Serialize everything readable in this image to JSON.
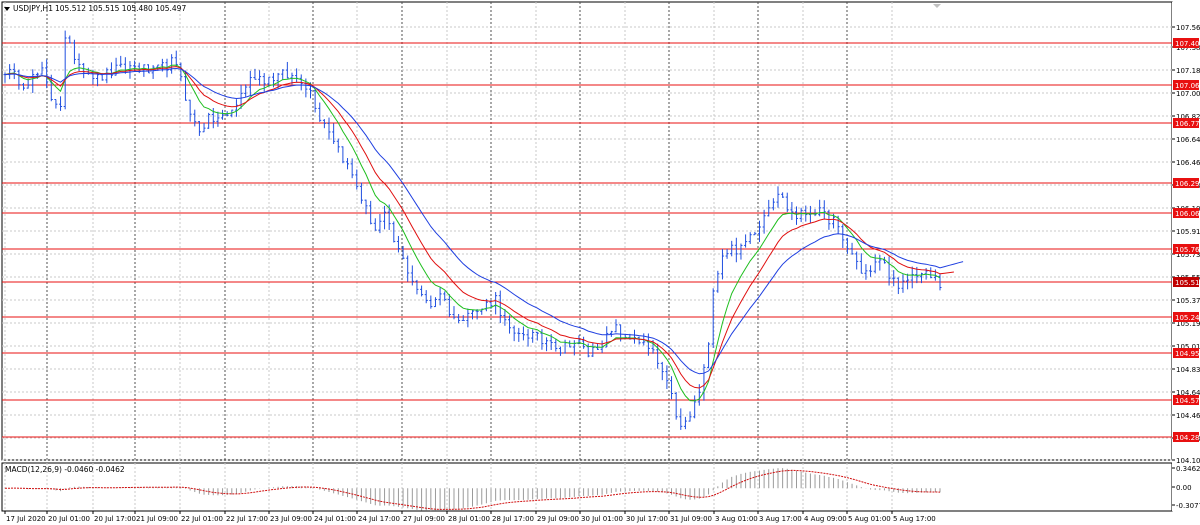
{
  "header": {
    "symbol_label": "USDJPY,H1",
    "ohlc_text": "105.512 105.515 105.480 105.497"
  },
  "macd_label": "MACD(12,26,9) -0.0460 -0.0462",
  "colors": {
    "candle": "#1f4fe0",
    "ma_fast": "#1fbf1f",
    "ma_mid": "#e01010",
    "ma_slow": "#1f3fe0",
    "level_line": "#e81010",
    "level_badge": "#e81010",
    "macd_signal": "#d01010",
    "macd_hist": "#9a9a9a",
    "grid": "#c8c8c8"
  },
  "chart_data": [
    {
      "type": "candlestick",
      "title": "USDJPY,H1",
      "ylim": [
        104.105,
        107.62
      ],
      "price_ticks": [
        "107.565",
        "107.385",
        "107.185",
        "107.005",
        "106.825",
        "106.640",
        "106.460",
        "106.280",
        "106.100",
        "105.915",
        "105.735",
        "105.555",
        "105.370",
        "105.190",
        "105.010",
        "104.830",
        "104.645",
        "104.465",
        "104.285",
        "104.105"
      ],
      "x_ticks": [
        "17 Jul 2020",
        "20 Jul 01:00",
        "20 Jul 17:00",
        "21 Jul 09:00",
        "22 Jul 01:00",
        "22 Jul 17:00",
        "23 Jul 09:00",
        "24 Jul 01:00",
        "24 Jul 17:00",
        "27 Jul 09:00",
        "28 Jul 01:00",
        "28 Jul 17:00",
        "29 Jul 09:00",
        "30 Jul 01:00",
        "30 Jul 17:00",
        "31 Jul 09:00",
        "3 Aug 01:00",
        "3 Aug 17:00",
        "4 Aug 09:00",
        "5 Aug 01:00",
        "5 Aug 17:00"
      ],
      "horizontal_levels": [
        "107.402",
        "107.062",
        "106.770",
        "106.294",
        "106.060",
        "105.761",
        "105.514",
        "105.240",
        "104.950",
        "104.575",
        "104.284"
      ],
      "current_price": "105.514",
      "price_path": [
        [
          0,
          107.22
        ],
        [
          4,
          107.12
        ],
        [
          8,
          107.2
        ],
        [
          10,
          107.0
        ],
        [
          12,
          106.95
        ],
        [
          13,
          107.45
        ],
        [
          16,
          107.28
        ],
        [
          20,
          107.15
        ],
        [
          24,
          107.22
        ],
        [
          28,
          107.25
        ],
        [
          32,
          107.2
        ],
        [
          36,
          107.28
        ],
        [
          38,
          107.18
        ],
        [
          40,
          106.85
        ],
        [
          42,
          106.75
        ],
        [
          44,
          106.82
        ],
        [
          48,
          106.85
        ],
        [
          50,
          106.95
        ],
        [
          52,
          107.1
        ],
        [
          54,
          107.18
        ],
        [
          56,
          107.15
        ],
        [
          60,
          107.18
        ],
        [
          64,
          107.15
        ],
        [
          66,
          107.05
        ],
        [
          68,
          106.85
        ],
        [
          70,
          106.75
        ],
        [
          72,
          106.6
        ],
        [
          74,
          106.45
        ],
        [
          76,
          106.3
        ],
        [
          78,
          106.1
        ],
        [
          80,
          105.95
        ],
        [
          82,
          106.05
        ],
        [
          84,
          105.85
        ],
        [
          86,
          105.7
        ],
        [
          88,
          105.55
        ],
        [
          90,
          105.4
        ],
        [
          92,
          105.35
        ],
        [
          94,
          105.45
        ],
        [
          96,
          105.3
        ],
        [
          98,
          105.2
        ],
        [
          100,
          105.32
        ],
        [
          102,
          105.28
        ],
        [
          104,
          105.35
        ],
        [
          106,
          105.4
        ],
        [
          108,
          105.2
        ],
        [
          110,
          105.08
        ],
        [
          112,
          105.12
        ],
        [
          114,
          105.1
        ],
        [
          116,
          105.05
        ],
        [
          118,
          105.08
        ],
        [
          120,
          104.98
        ],
        [
          122,
          105.05
        ],
        [
          124,
          105.03
        ],
        [
          126,
          104.95
        ],
        [
          128,
          105.02
        ],
        [
          130,
          105.08
        ],
        [
          132,
          105.15
        ],
        [
          134,
          105.05
        ],
        [
          136,
          105.1
        ],
        [
          138,
          105.02
        ],
        [
          140,
          104.95
        ],
        [
          142,
          104.8
        ],
        [
          144,
          104.6
        ],
        [
          146,
          104.35
        ],
        [
          148,
          104.45
        ],
        [
          150,
          104.65
        ],
        [
          152,
          105.0
        ],
        [
          153,
          105.5
        ],
        [
          155,
          105.75
        ],
        [
          157,
          105.8
        ],
        [
          159,
          105.78
        ],
        [
          161,
          105.9
        ],
        [
          163,
          106.0
        ],
        [
          165,
          106.15
        ],
        [
          167,
          106.25
        ],
        [
          169,
          106.12
        ],
        [
          171,
          106.05
        ],
        [
          173,
          106.08
        ],
        [
          175,
          106.1
        ],
        [
          177,
          106.05
        ],
        [
          179,
          106.02
        ],
        [
          181,
          105.85
        ],
        [
          183,
          105.75
        ],
        [
          185,
          105.62
        ],
        [
          187,
          105.6
        ],
        [
          189,
          105.72
        ],
        [
          191,
          105.6
        ],
        [
          193,
          105.45
        ],
        [
          195,
          105.55
        ],
        [
          197,
          105.6
        ],
        [
          199,
          105.58
        ],
        [
          201,
          105.55
        ],
        [
          202,
          105.5
        ]
      ]
    },
    {
      "type": "macd",
      "title": "MACD(12,26,9)",
      "ylim": [
        -0.3077,
        0.3462
      ],
      "ticks": [
        "0.3462",
        "0.00",
        "-0.3077"
      ],
      "main": -0.046,
      "signal": -0.0462
    }
  ]
}
